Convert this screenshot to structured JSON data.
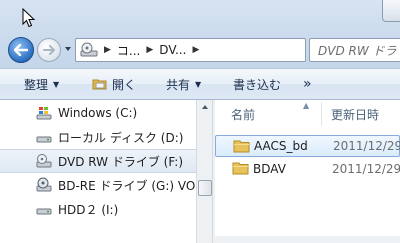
{
  "address": {
    "crumbs": [
      "コ...",
      "DV..."
    ],
    "search_placeholder": "DVD RW ドラ"
  },
  "toolbar": {
    "organize": "整理",
    "open": "開く",
    "share": "共有",
    "burn": "書き込む",
    "more": "»"
  },
  "tree": [
    {
      "label": "Windows (C:)",
      "icon": "windows-drive-icon"
    },
    {
      "label": "ローカル ディスク (D:)",
      "icon": "hard-drive-icon"
    },
    {
      "label": "DVD RW ドライブ (F:)",
      "icon": "dvd-drive-icon",
      "selected": true
    },
    {
      "label": "BD-RE ドライブ (G:) VO",
      "icon": "bd-drive-icon"
    },
    {
      "label": "HDD２ (I:)",
      "icon": "hard-drive-icon"
    }
  ],
  "columns": {
    "name": "名前",
    "modified": "更新日時"
  },
  "files": [
    {
      "name": "AACS_bd",
      "date": "2011/12/29",
      "selected": true
    },
    {
      "name": "BDAV",
      "date": "2011/12/29"
    }
  ],
  "colors": {
    "selection_border": "#84acdd",
    "folder": "#e8c25a"
  }
}
